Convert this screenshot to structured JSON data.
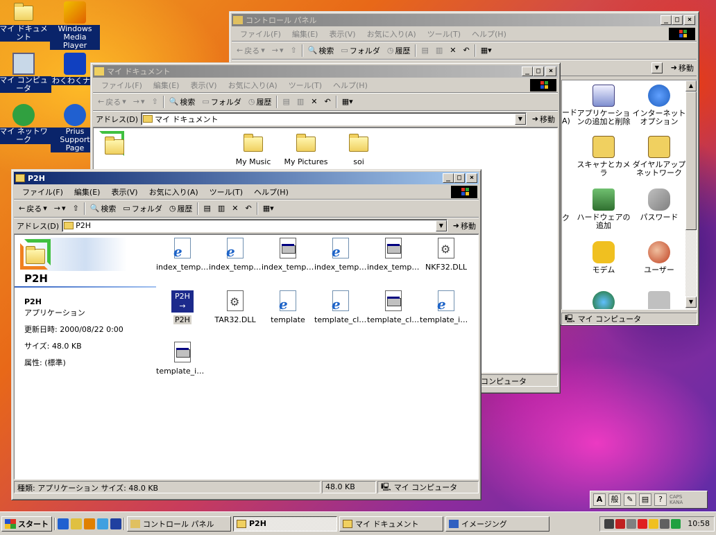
{
  "desktop": {
    "icons": [
      {
        "label": "マイ ドキュメント"
      },
      {
        "label": "Windows Media Player"
      },
      {
        "label": "マイ コンピュータ"
      },
      {
        "label": "わくわくナビ"
      },
      {
        "label": "マイ ネットワーク"
      },
      {
        "label": "Prius Support Page"
      }
    ]
  },
  "control_panel": {
    "title": "コントロール パネル",
    "menu": [
      "ファイル(F)",
      "編集(E)",
      "表示(V)",
      "お気に入り(A)",
      "ツール(T)",
      "ヘルプ(H)"
    ],
    "toolbar": {
      "back": "戻る",
      "search": "検索",
      "folders": "フォルダ",
      "history": "履歴"
    },
    "go": "移動",
    "items": [
      {
        "label": "アプリケーションの追加と削除"
      },
      {
        "label": "インターネット オプション"
      },
      {
        "label": "スキャナとカメラ"
      },
      {
        "label": "ダイヤルアップ ネットワーク"
      },
      {
        "label": "ハードウェアの追加"
      },
      {
        "label": "パスワード"
      },
      {
        "label": "モデム"
      },
      {
        "label": "ユーザー"
      }
    ],
    "partial_items": [
      "ード",
      "A)",
      "ク"
    ],
    "status": "マイ コンピュータ"
  },
  "my_documents": {
    "title": "マイ ドキュメント",
    "menu": [
      "ファイル(F)",
      "編集(E)",
      "表示(V)",
      "お気に入り(A)",
      "ツール(T)",
      "ヘルプ(H)"
    ],
    "toolbar": {
      "back": "戻る",
      "search": "検索",
      "folders": "フォルダ",
      "history": "履歴"
    },
    "address_label": "アドレス(D)",
    "address_value": "マイ ドキュメント",
    "go": "移動",
    "items": [
      {
        "label": "My Music"
      },
      {
        "label": "My Pictures"
      },
      {
        "label": "soi"
      }
    ],
    "status": "コンピュータ"
  },
  "p2h": {
    "title": "P2H",
    "menu": [
      "ファイル(F)",
      "編集(E)",
      "表示(V)",
      "お気に入り(A)",
      "ツール(T)",
      "ヘルプ(H)"
    ],
    "toolbar": {
      "back": "戻る",
      "search": "検索",
      "folders": "フォルダ",
      "history": "履歴"
    },
    "address_label": "アドレス(D)",
    "address_value": "P2H",
    "go": "移動",
    "webview": {
      "folder_name": "P2H",
      "item_name": "P2H",
      "item_type": "アプリケーション",
      "modified": "更新日時: 2000/08/22 0:00",
      "size": "サイズ: 48.0 KB",
      "attributes": "属性: (標準)"
    },
    "files": [
      {
        "label": "index_templ...",
        "kind": "ie"
      },
      {
        "label": "index_templ...",
        "kind": "ie"
      },
      {
        "label": "index_templ...",
        "kind": "html"
      },
      {
        "label": "index_templ...",
        "kind": "ie"
      },
      {
        "label": "index_templ...",
        "kind": "html"
      },
      {
        "label": "NKF32.DLL",
        "kind": "dll"
      },
      {
        "label": "P2H",
        "kind": "app"
      },
      {
        "label": "TAR32.DLL",
        "kind": "dll"
      },
      {
        "label": "template",
        "kind": "ie"
      },
      {
        "label": "template_cla...",
        "kind": "ie"
      },
      {
        "label": "template_cla...",
        "kind": "html"
      },
      {
        "label": "template_iw99",
        "kind": "ie"
      },
      {
        "label": "template_iw9...",
        "kind": "html"
      }
    ],
    "status": {
      "info": "種類: アプリケーション サイズ: 48.0 KB",
      "size": "48.0 KB",
      "zone": "マイ コンピュータ"
    }
  },
  "taskbar": {
    "start": "スタート",
    "tasks": [
      {
        "label": "コントロール パネル",
        "active": false
      },
      {
        "label": "P2H",
        "active": true
      },
      {
        "label": "マイ ドキュメント",
        "active": false
      },
      {
        "label": "イメージング",
        "active": false
      }
    ],
    "clock": "10:58"
  },
  "ime": {
    "mode": "般",
    "caps": "CAPS",
    "kana": "KANA"
  }
}
